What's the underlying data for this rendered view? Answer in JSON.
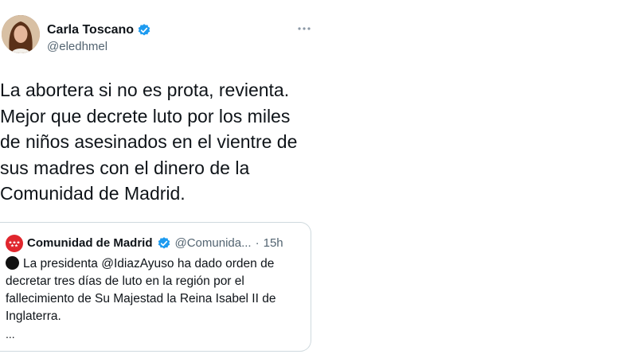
{
  "author": {
    "name": "Carla Toscano",
    "handle": "@eledhmel",
    "verified": true
  },
  "tweet": {
    "text": "La abortera si no es prota, revienta.\nMejor que decrete luto por los miles\nde niños asesinados en el vientre de\nsus madres con el dinero de la\nComunidad de Madrid."
  },
  "quoted_tweet": {
    "author_name": "Comunidad de Madrid",
    "handle": "@Comunida...",
    "separator": "·",
    "time": "15h",
    "text": "La presidenta @IdiazAyuso ha dado orden de decretar tres días de luto en la región por el fallecimiento de Su Majestad la Reina Isabel II de Inglaterra.",
    "ellipsis": "..."
  },
  "colors": {
    "verified_blue": "#1d9bf0",
    "secondary_text": "#536471",
    "border": "#cfd9de",
    "madrid_red": "#e0262d"
  },
  "icons": {
    "more": "more-dots-icon",
    "verified": "verified-badge-icon",
    "bullet": "black-circle-icon"
  }
}
